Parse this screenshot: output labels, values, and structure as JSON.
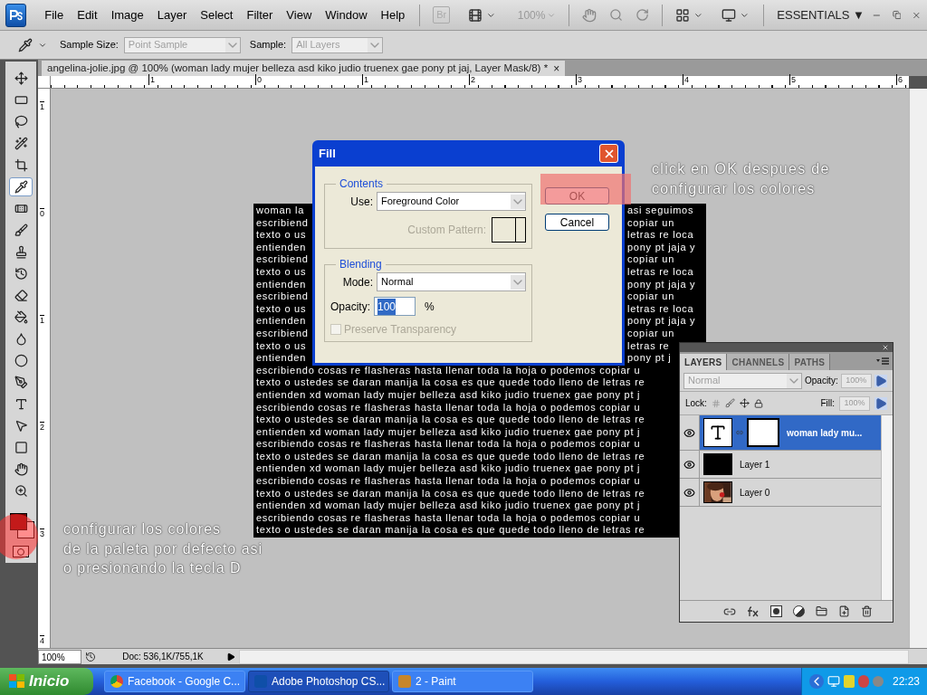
{
  "app_bar": {
    "menus": [
      "File",
      "Edit",
      "Image",
      "Layer",
      "Select",
      "Filter",
      "View",
      "Window",
      "Help"
    ],
    "bridge": "Br",
    "zoom": "100%",
    "workspace": "ESSENTIALS ▼"
  },
  "options_bar": {
    "sample_size_label": "Sample Size:",
    "sample_size": "Point Sample",
    "sample_label": "Sample:",
    "sample": "All Layers"
  },
  "document_tab": {
    "title": "angelina-jolie.jpg @ 100% (woman lady mujer belleza asd kiko judio truenex gae pony pt jaj, Layer Mask/8) *",
    "close": "×"
  },
  "tools": [
    {
      "selected": false
    },
    {
      "selected": false
    },
    {
      "selected": false
    },
    {
      "selected": false
    },
    {
      "selected": false
    },
    {
      "selected": true
    },
    {
      "selected": false
    },
    {
      "selected": false
    },
    {
      "selected": false
    },
    {
      "selected": false
    },
    {
      "selected": false
    },
    {
      "selected": false
    },
    {
      "selected": false
    },
    {
      "selected": false
    },
    {
      "selected": false
    },
    {
      "selected": false
    },
    {
      "selected": false
    },
    {
      "selected": false
    },
    {
      "selected": false
    },
    {
      "selected": false
    }
  ],
  "foreground_swatch": {
    "color": "#7a0000"
  },
  "top_ruler": [
    "1",
    "0",
    "1",
    "2",
    "3",
    "4",
    "5",
    "6"
  ],
  "left_ruler": [
    "1",
    "0",
    "1",
    "2",
    "3",
    "4"
  ],
  "canvas_rows": [
    {
      "left": "woman la",
      "right": "asi seguimos"
    },
    {
      "left": "escribiend",
      "right": "copiar un"
    },
    {
      "left": "texto o us",
      "right": "letras re loca"
    },
    {
      "left": "entienden",
      "right": "pony pt jaja y"
    },
    {
      "left": "escribiend",
      "right": "copiar un"
    },
    {
      "left": "texto o us",
      "right": "letras re loca"
    },
    {
      "left": "entienden",
      "right": "pony pt jaja y"
    },
    {
      "left": "escribiend",
      "right": "copiar un"
    },
    {
      "left": "texto o us",
      "right": "letras re loca"
    },
    {
      "left": "entienden",
      "right": "pony pt jaja y"
    },
    {
      "left": "escribiend",
      "right": "copiar un"
    },
    {
      "left": "texto o us",
      "right": "letras re"
    },
    {
      "left": "entienden",
      "right": "pony pt j"
    },
    {
      "left": "escribiendo cosas re flasheras hasta llenar toda la hoja o podemos copiar u"
    },
    {
      "left": "texto o ustedes se daran manija la cosa es que quede todo lleno de letras re"
    },
    {
      "left": "entienden xd woman lady mujer belleza asd kiko judio truenex gae pony pt j"
    },
    {
      "left": "escribiendo cosas re flasheras hasta llenar toda la hoja o podemos copiar u"
    },
    {
      "left": "texto o ustedes se daran manija la cosa es que quede todo lleno de letras re"
    },
    {
      "left": "entienden xd woman lady mujer belleza asd kiko judio truenex gae pony pt j"
    },
    {
      "left": "escribiendo cosas re flasheras hasta llenar toda la hoja o podemos copiar u"
    },
    {
      "left": "texto o ustedes se daran manija la cosa es que quede todo lleno de letras re"
    },
    {
      "left": "entienden xd woman lady mujer belleza asd kiko judio truenex gae pony pt j"
    },
    {
      "left": "escribiendo cosas re flasheras hasta llenar toda la hoja o podemos copiar u"
    },
    {
      "left": "texto o ustedes se daran manija la cosa es que quede todo lleno de letras re"
    },
    {
      "left": "entienden xd woman lady mujer belleza asd kiko judio truenex gae pony pt j"
    },
    {
      "left": "escribiendo cosas re flasheras hasta llenar toda la hoja o podemos copiar u"
    },
    {
      "left": "texto o ustedes se daran manija la cosa es que quede todo lleno de letras re"
    }
  ],
  "fill_dialog": {
    "title": "Fill",
    "contents_legend": "Contents",
    "use_label": "Use:",
    "use_value": "Foreground Color",
    "pattern_label": "Custom Pattern:",
    "blending_legend": "Blending",
    "mode_label": "Mode:",
    "mode_value": "Normal",
    "opacity_label": "Opacity:",
    "opacity_value": "100",
    "percent": "%",
    "preserve_label": "Preserve Transparency",
    "preserve_checked": false,
    "preserve_disabled": true,
    "ok": "OK",
    "cancel": "Cancel"
  },
  "annotations": [
    {
      "lines": [
        "click en OK despues de",
        "configurar los colores"
      ]
    },
    {
      "lines": [
        "configurar los colores",
        "de la paleta por defecto asi",
        "o presionando la tecla D"
      ]
    }
  ],
  "layers_panel": {
    "tabs": [
      {
        "label": "LAYERS",
        "selected": true
      },
      {
        "label": "CHANNELS",
        "selected": false
      },
      {
        "label": "PATHS",
        "selected": false
      }
    ],
    "blend_mode": "Normal",
    "opacity_label": "Opacity:",
    "opacity": "100%",
    "lock_label": "Lock:",
    "fill_label": "Fill:",
    "fill": "100%",
    "layers": [
      {
        "name": "woman lady mu...",
        "kind": "text",
        "selected": true,
        "visible": true
      },
      {
        "name": "Layer 1",
        "kind": "fill",
        "selected": false,
        "visible": true
      },
      {
        "name": "Layer 0",
        "selected": false,
        "visible": true
      }
    ]
  },
  "status_bar": {
    "zoom": "100%",
    "doc": "Doc: 536,1K/755,1K"
  },
  "taskbar": {
    "start": "Inicio",
    "tasks": [
      {
        "label": "Facebook - Google C...",
        "selected": false
      },
      {
        "label": "Adobe Photoshop CS...",
        "selected": true
      },
      {
        "label": "2 - Paint",
        "selected": false
      }
    ],
    "clock": "22:23"
  }
}
